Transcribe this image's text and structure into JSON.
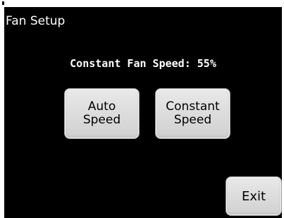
{
  "header": {
    "title": "Fan Setup"
  },
  "status": {
    "text": "Constant Fan Speed: 55%",
    "fan_speed_percent": 55
  },
  "buttons": {
    "auto_speed": [
      "Auto",
      "Speed"
    ],
    "constant_speed": [
      "Constant",
      "Speed"
    ],
    "exit": "Exit"
  },
  "colors": {
    "screen_background": "#000000",
    "text": "#ffffff",
    "button_face": "#dcdcdc",
    "button_text": "#000000"
  }
}
